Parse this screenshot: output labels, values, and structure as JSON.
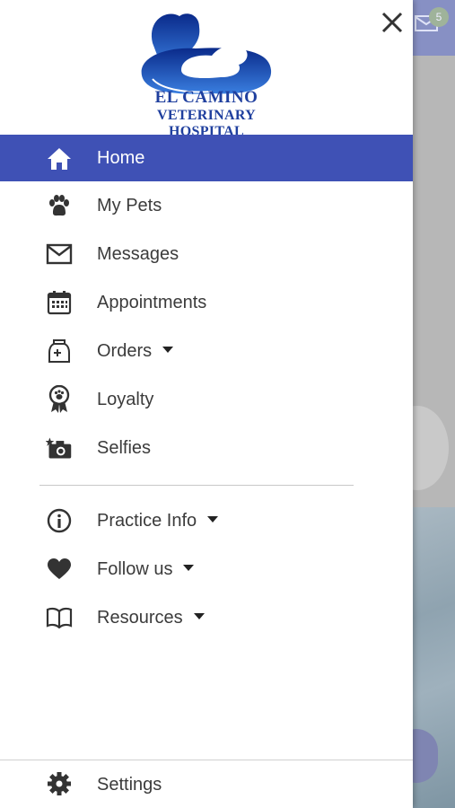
{
  "app": {
    "logo_line1": "El Camino",
    "logo_line2": "Veterinary Hospital",
    "brand_color": "#3f51b5"
  },
  "background": {
    "mail_badge_count": "5"
  },
  "drawer": {
    "close_icon": "close-icon",
    "primary_items": [
      {
        "label": "Home",
        "icon": "home-icon",
        "active": true
      },
      {
        "label": "My Pets",
        "icon": "paw-icon"
      },
      {
        "label": "Messages",
        "icon": "envelope-icon"
      },
      {
        "label": "Appointments",
        "icon": "calendar-icon"
      },
      {
        "label": "Orders",
        "icon": "food-bag-icon",
        "expandable": true
      },
      {
        "label": "Loyalty",
        "icon": "award-ribbon-icon"
      },
      {
        "label": "Selfies",
        "icon": "camera-star-icon"
      }
    ],
    "secondary_items": [
      {
        "label": "Practice Info",
        "icon": "info-icon",
        "expandable": true
      },
      {
        "label": "Follow us",
        "icon": "heart-icon",
        "expandable": true
      },
      {
        "label": "Resources",
        "icon": "book-icon",
        "expandable": true
      }
    ],
    "settings": {
      "label": "Settings",
      "icon": "gear-icon"
    }
  }
}
